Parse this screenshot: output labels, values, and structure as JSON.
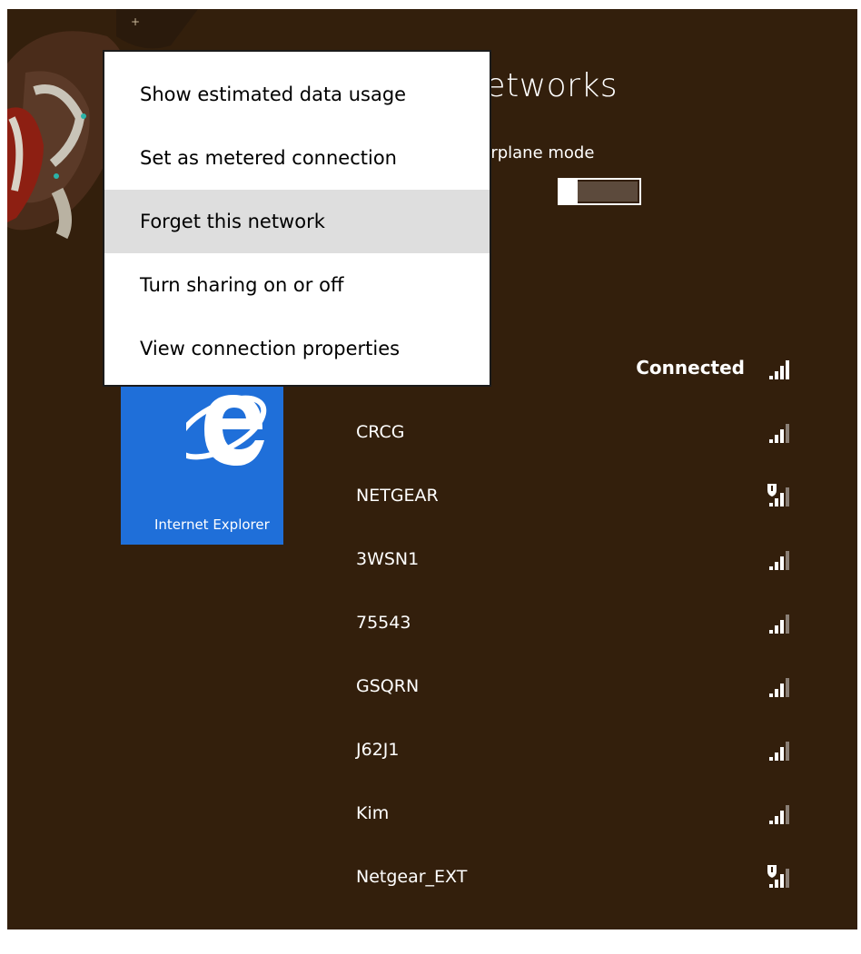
{
  "context_menu": {
    "items": [
      {
        "label": "Show estimated data usage"
      },
      {
        "label": "Set as metered connection"
      },
      {
        "label": "Forget this network"
      },
      {
        "label": "Turn sharing on or off"
      },
      {
        "label": "View connection properties"
      }
    ],
    "hovered_index": 2
  },
  "pane": {
    "title": "Networks",
    "airplane_mode_label": "Airplane mode",
    "airplane_mode_on": false
  },
  "start_tile": {
    "label": "Internet Explorer",
    "icon": "internet-explorer-icon"
  },
  "networks": [
    {
      "name": "",
      "status": "Connected",
      "secured_warning": false
    },
    {
      "name": "CRCG",
      "status": "",
      "secured_warning": false
    },
    {
      "name": "NETGEAR",
      "status": "",
      "secured_warning": true
    },
    {
      "name": "3WSN1",
      "status": "",
      "secured_warning": false
    },
    {
      "name": "75543",
      "status": "",
      "secured_warning": false
    },
    {
      "name": "GSQRN",
      "status": "",
      "secured_warning": false
    },
    {
      "name": "J62J1",
      "status": "",
      "secured_warning": false
    },
    {
      "name": "Kim",
      "status": "",
      "secured_warning": false
    },
    {
      "name": "Netgear_EXT",
      "status": "",
      "secured_warning": true
    }
  ],
  "colors": {
    "background": "#331f0c",
    "tile": "#1f6fd9",
    "menu_hover": "#dedede"
  }
}
